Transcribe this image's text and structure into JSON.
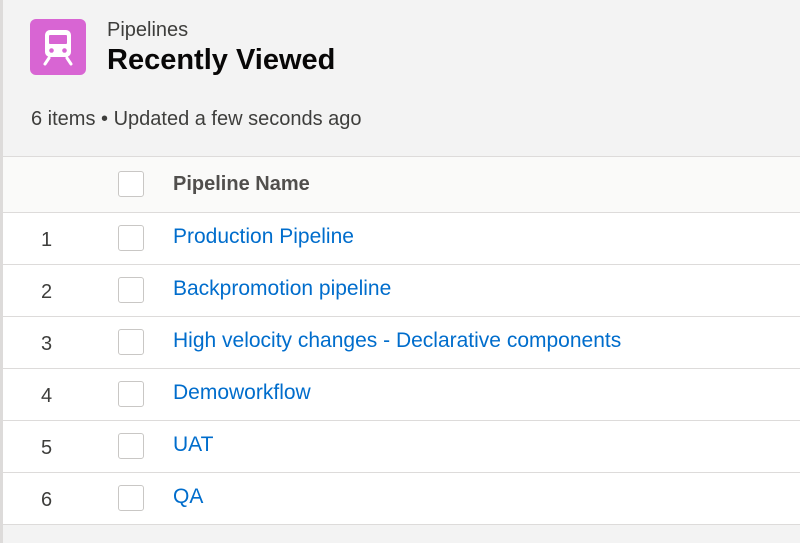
{
  "header": {
    "object_label": "Pipelines",
    "list_title": "Recently Viewed",
    "meta": "6 items • Updated a few seconds ago",
    "icon": "pipeline-train-icon",
    "icon_color": "#d865d3"
  },
  "table": {
    "columns": [
      "Pipeline Name"
    ],
    "rows": [
      {
        "num": "1",
        "name": "Production Pipeline"
      },
      {
        "num": "2",
        "name": "Backpromotion pipeline"
      },
      {
        "num": "3",
        "name": "High velocity changes - Declarative components"
      },
      {
        "num": "4",
        "name": "Demoworkflow"
      },
      {
        "num": "5",
        "name": "UAT"
      },
      {
        "num": "6",
        "name": "QA"
      }
    ]
  },
  "colors": {
    "link": "#006dcc",
    "background": "#f3f3f3",
    "border": "#dddbda"
  }
}
